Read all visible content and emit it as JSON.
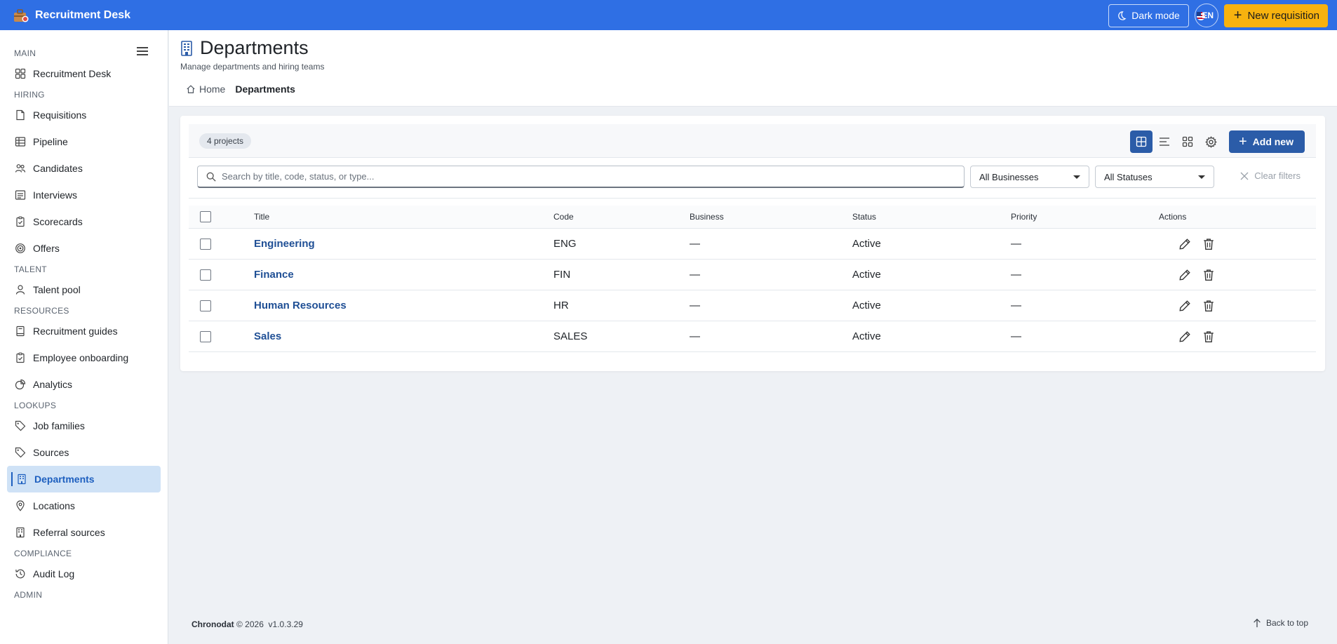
{
  "app": {
    "title": "Recruitment Desk",
    "dark_mode_label": "Dark mode",
    "language": "EN",
    "new_requisition_label": "New requisition"
  },
  "sidebar": {
    "sections": [
      {
        "label": "MAIN",
        "items": [
          {
            "label": "Recruitment Desk",
            "icon": "grid-icon"
          }
        ]
      },
      {
        "label": "HIRING",
        "items": [
          {
            "label": "Requisitions",
            "icon": "document-icon"
          },
          {
            "label": "Pipeline",
            "icon": "table-icon"
          },
          {
            "label": "Candidates",
            "icon": "people-icon"
          },
          {
            "label": "Interviews",
            "icon": "list-icon"
          },
          {
            "label": "Scorecards",
            "icon": "clipboard-check-icon"
          },
          {
            "label": "Offers",
            "icon": "target-icon"
          }
        ]
      },
      {
        "label": "TALENT",
        "items": [
          {
            "label": "Talent pool",
            "icon": "person-icon"
          }
        ]
      },
      {
        "label": "RESOURCES",
        "items": [
          {
            "label": "Recruitment guides",
            "icon": "book-icon"
          },
          {
            "label": "Employee onboarding",
            "icon": "clipboard-icon"
          },
          {
            "label": "Analytics",
            "icon": "chart-icon"
          }
        ]
      },
      {
        "label": "LOOKUPS",
        "items": [
          {
            "label": "Job families",
            "icon": "tag-icon"
          },
          {
            "label": "Sources",
            "icon": "tag-icon"
          },
          {
            "label": "Departments",
            "icon": "building-icon",
            "active": true
          },
          {
            "label": "Locations",
            "icon": "pin-icon"
          },
          {
            "label": "Referral sources",
            "icon": "building-icon"
          }
        ]
      },
      {
        "label": "COMPLIANCE",
        "items": [
          {
            "label": "Audit Log",
            "icon": "history-icon"
          }
        ]
      },
      {
        "label": "ADMIN",
        "items": []
      }
    ]
  },
  "page": {
    "title": "Departments",
    "subtitle": "Manage departments and hiring teams",
    "breadcrumb": {
      "home": "Home",
      "current": "Departments"
    }
  },
  "toolbar": {
    "count_label": "4 projects",
    "add_new_label": "Add new"
  },
  "filters": {
    "search_placeholder": "Search by title, code, status, or type...",
    "business_select": "All Businesses",
    "status_select": "All Statuses",
    "clear_label": "Clear filters"
  },
  "table": {
    "headers": {
      "title": "Title",
      "code": "Code",
      "business": "Business",
      "status": "Status",
      "priority": "Priority",
      "actions": "Actions"
    },
    "rows": [
      {
        "title": "Engineering",
        "code": "ENG",
        "business": "—",
        "status": "Active",
        "priority": "—"
      },
      {
        "title": "Finance",
        "code": "FIN",
        "business": "—",
        "status": "Active",
        "priority": "—"
      },
      {
        "title": "Human Resources",
        "code": "HR",
        "business": "—",
        "status": "Active",
        "priority": "—"
      },
      {
        "title": "Sales",
        "code": "SALES",
        "business": "—",
        "status": "Active",
        "priority": "—"
      }
    ]
  },
  "footer": {
    "brand": "Chronodat",
    "copyright": "© 2026",
    "version": "v1.0.3.29",
    "back_to_top": "Back to top"
  },
  "colors": {
    "primary": "#2f6fe4",
    "accent": "#f7b20f",
    "button": "#2b5ca8",
    "link": "#1f4f95",
    "active_bg": "#cfe2f6"
  }
}
